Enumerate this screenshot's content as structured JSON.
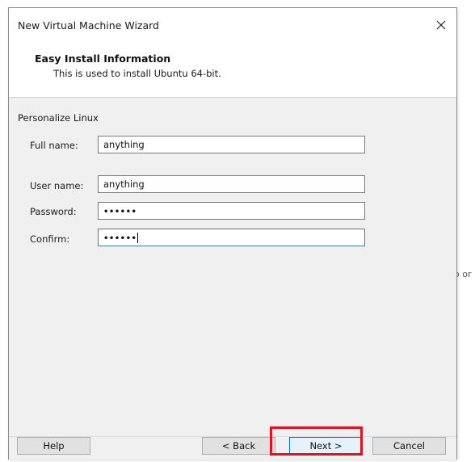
{
  "background_window": {
    "clipped_text": "o or"
  },
  "window": {
    "title": "New Virtual Machine Wizard",
    "close_glyph": "×"
  },
  "header": {
    "title": "Easy Install Information",
    "subtitle": "This is used to install Ubuntu 64-bit."
  },
  "form": {
    "group_label": "Personalize Linux",
    "fields": [
      {
        "label": "Full name:",
        "value": "anything"
      },
      {
        "label": "User name:",
        "value": "anything"
      },
      {
        "label": "Password:",
        "value": "••••••"
      },
      {
        "label": "Confirm:",
        "value": "••••••"
      }
    ]
  },
  "buttons": {
    "help": "Help",
    "back": "< Back",
    "next": "Next >",
    "cancel": "Cancel"
  },
  "colors": {
    "highlight": "#e0141e",
    "focus_border": "#3c7fb1",
    "primary_button_border": "#0078d7"
  },
  "icons": {
    "close": "close-icon"
  }
}
